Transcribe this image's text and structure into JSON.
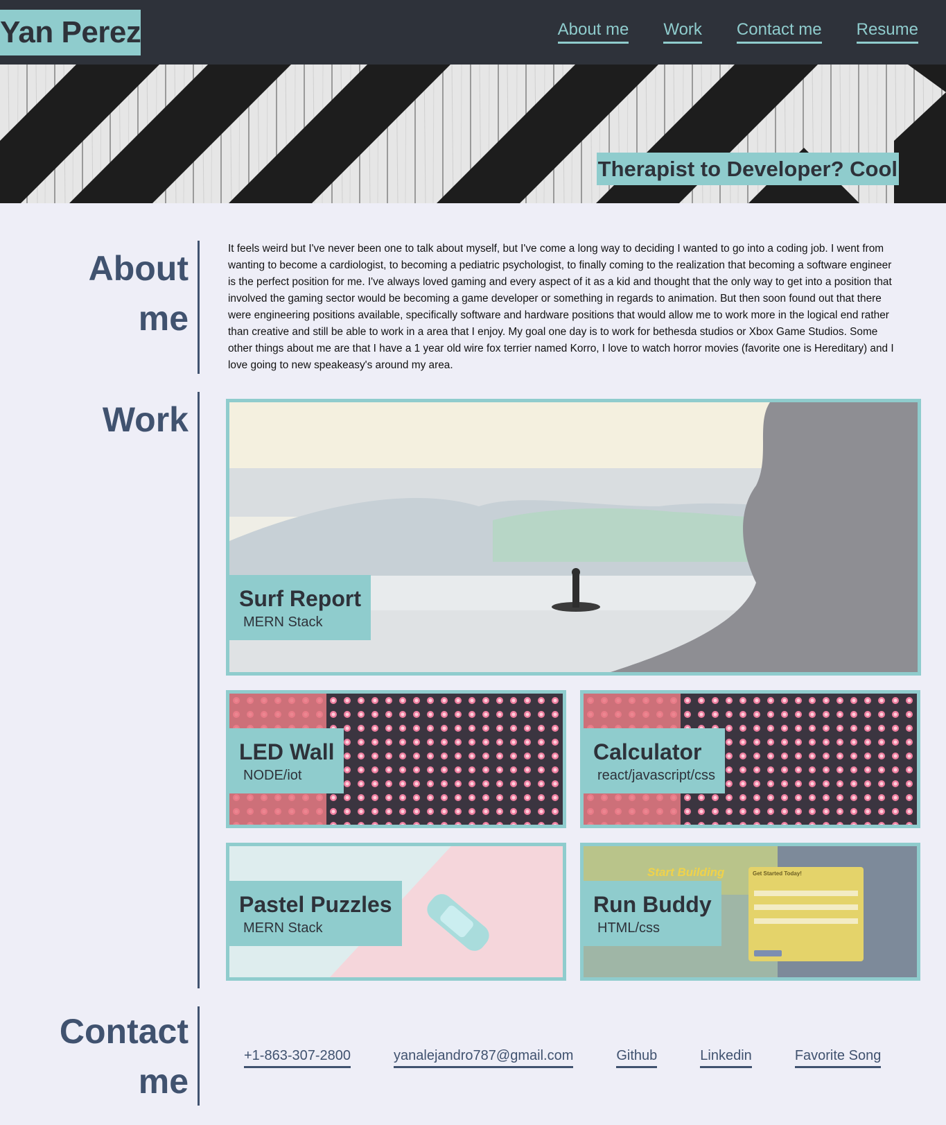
{
  "header": {
    "logo": "Yan Perez",
    "nav": [
      "About me",
      "Work",
      "Contact me",
      "Resume"
    ]
  },
  "hero": {
    "tagline": "Therapist to Developer? Cool"
  },
  "about": {
    "title_line1": "About",
    "title_line2": "me",
    "text": "It feels weird but I've never been one to talk about myself, but I've come a long way to deciding I wanted to go into a coding job. I went from wanting to become a cardiologist, to becoming a pediatric psychologist, to finally coming to the realization that becoming a software engineer is the perfect position for me. I've always loved gaming and every aspect of it as a kid and thought that the only way to get into a position that involved the gaming sector would be becoming a game developer or something in regards to animation. But then soon found out that there were engineering positions available, specifically software and hardware positions that would allow me to work more in the logical end rather than creative and still be able to work in a area that I enjoy. My goal one day is to work for bethesda studios or Xbox Game Studios. Some other things about me are that I have a 1 year old wire fox terrier named Korro, I love to watch horror movies (favorite one is Hereditary) and I love going to new speakeasy's around my area."
  },
  "work": {
    "title": "Work",
    "projects": [
      {
        "name": "Surf Report",
        "tech": "MERN Stack"
      },
      {
        "name": "LED Wall",
        "tech": "NODE/iot"
      },
      {
        "name": "Calculator",
        "tech": "react/javascript/css"
      },
      {
        "name": "Pastel Puzzles",
        "tech": "MERN Stack"
      },
      {
        "name": "Run Buddy",
        "tech": "HTML/css"
      }
    ],
    "run_buddy_shot": {
      "headline": "Start Building",
      "form_title": "Get Started Today!"
    }
  },
  "contact": {
    "title_line1": "Contact",
    "title_line2": "me",
    "links": [
      "+1-863-307-2800",
      "yanalejandro787@gmail.com",
      "Github",
      "Linkedin",
      "Favorite Song"
    ]
  },
  "colors": {
    "accent": "#8fcccd",
    "header_bg": "#2e323a",
    "heading": "#40526f",
    "page_bg": "#eeeef7"
  }
}
